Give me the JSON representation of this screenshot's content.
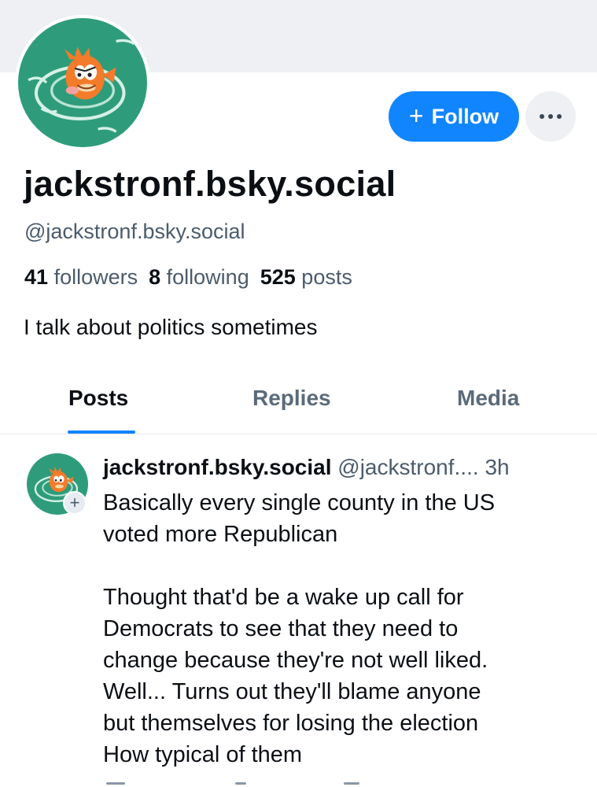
{
  "profile": {
    "display_name": "jackstronf.bsky.social",
    "handle": "@jackstronf.bsky.social",
    "bio": "I talk about politics sometimes",
    "avatar_icon": "cartoon-fish-avatar-icon"
  },
  "stats": {
    "followers_count": "41",
    "followers_label": "followers",
    "following_count": "8",
    "following_label": "following",
    "posts_count": "525",
    "posts_label": "posts"
  },
  "actions": {
    "follow_label": "Follow",
    "follow_icon": "plus-icon",
    "more_icon": "ellipsis-icon"
  },
  "tabs": [
    {
      "label": "Posts",
      "active": true
    },
    {
      "label": "Replies",
      "active": false
    },
    {
      "label": "Media",
      "active": false
    }
  ],
  "post": {
    "author": "jackstronf.bsky.social",
    "handle": "@jackstronf....",
    "time": "3h",
    "text": "Basically every single county in the US\nvoted more Republican\n\nThought that'd be a wake up call for\nDemocrats to see that they need to\nchange because they're not well liked.\nWell... Turns out they'll blame anyone\nbut themselves for losing the election\nHow typical of them"
  },
  "colors": {
    "accent": "#1185fe",
    "banner": "#eef0f3",
    "muted_text": "#4b5b6c",
    "avatar_bg": "#2e9c7a"
  }
}
